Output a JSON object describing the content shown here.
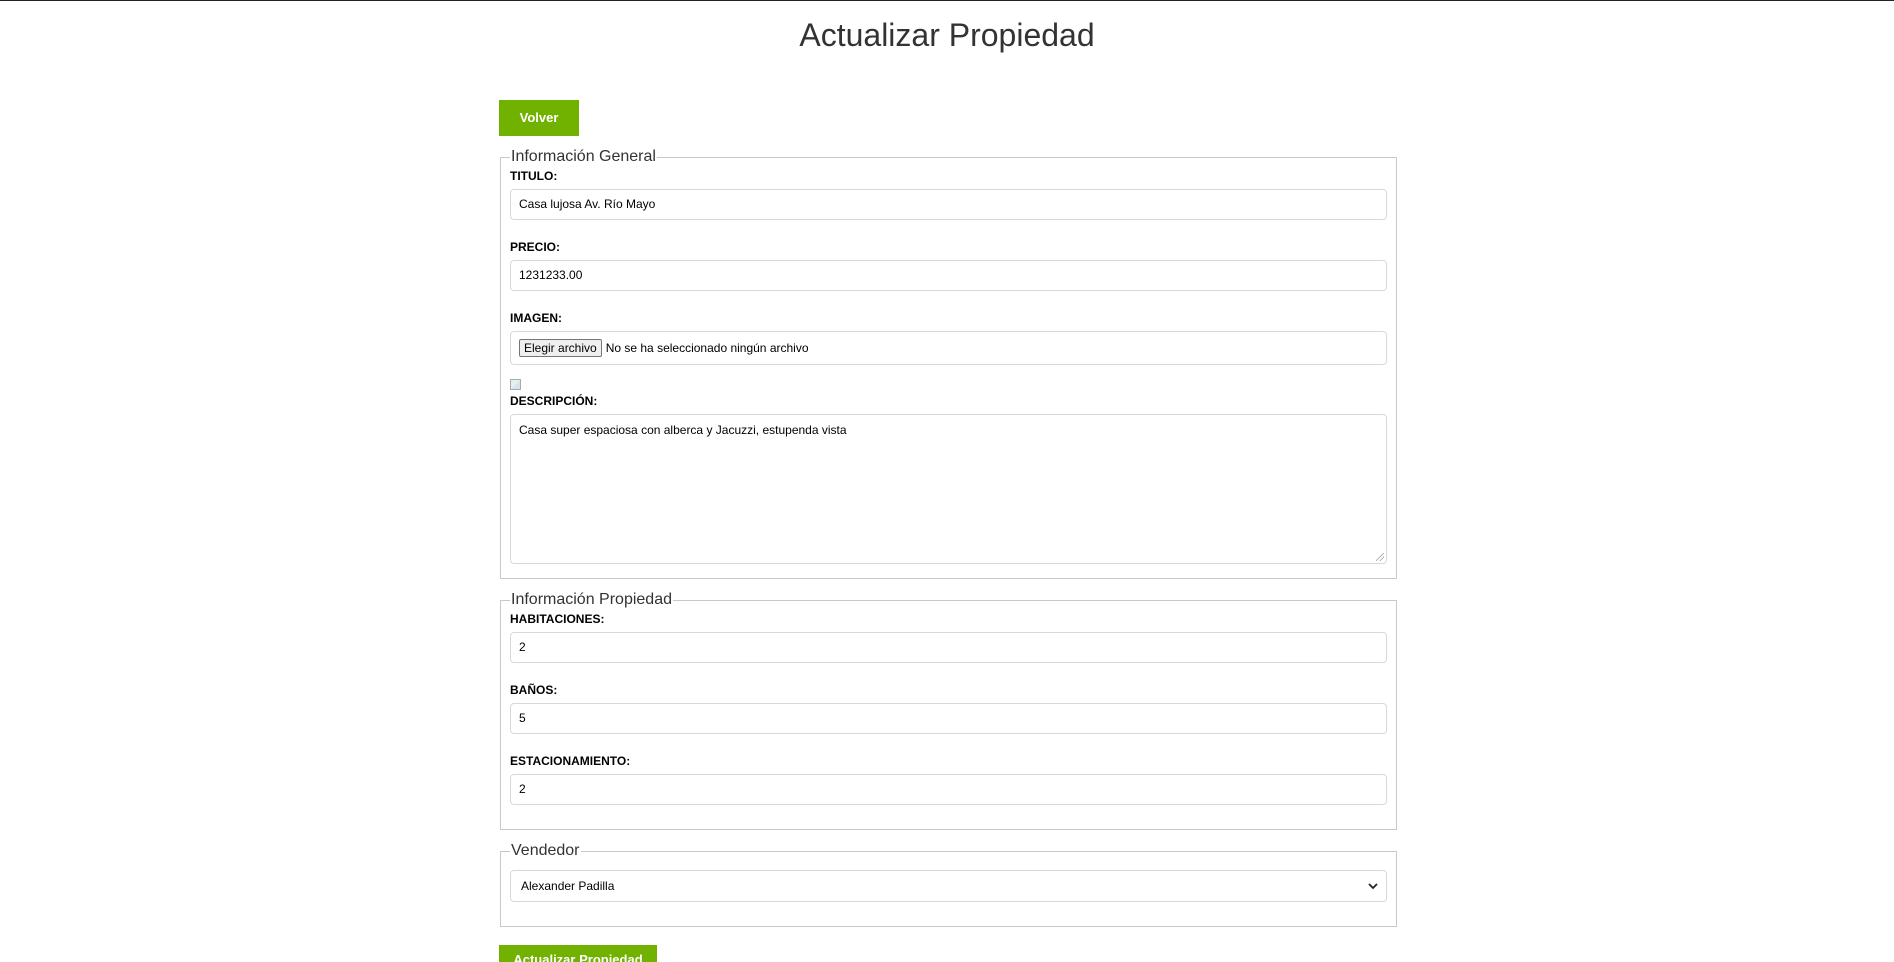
{
  "page": {
    "title": "Actualizar Propiedad"
  },
  "actions": {
    "back_label": "Volver",
    "submit_label": "Actualizar Propiedad"
  },
  "general_info": {
    "legend": "Información General",
    "title_label": "TITULO:",
    "title_value": "Casa lujosa Av. Río Mayo",
    "price_label": "PRECIO:",
    "price_value": "1231233.00",
    "image_label": "IMAGEN:",
    "file_button_label": "Elegir archivo",
    "file_status": "No se ha seleccionado ningún archivo",
    "description_label": "DESCRIPCIÓN:",
    "description_value": "Casa super espaciosa con alberca y Jacuzzi, estupenda vista"
  },
  "property_info": {
    "legend": "Información Propiedad",
    "rooms_label": "HABITACIONES:",
    "rooms_value": "2",
    "baths_label": "BAÑOS:",
    "baths_value": "5",
    "parking_label": "ESTACIONAMIENTO:",
    "parking_value": "2"
  },
  "seller": {
    "legend": "Vendedor",
    "selected": "Alexander Padilla"
  },
  "colors": {
    "accent": "#71b100"
  },
  "icons": {
    "select_arrow": "chevron-down-icon",
    "textarea_grip": "resize-grip-icon",
    "image_preview": "broken-image-icon"
  }
}
